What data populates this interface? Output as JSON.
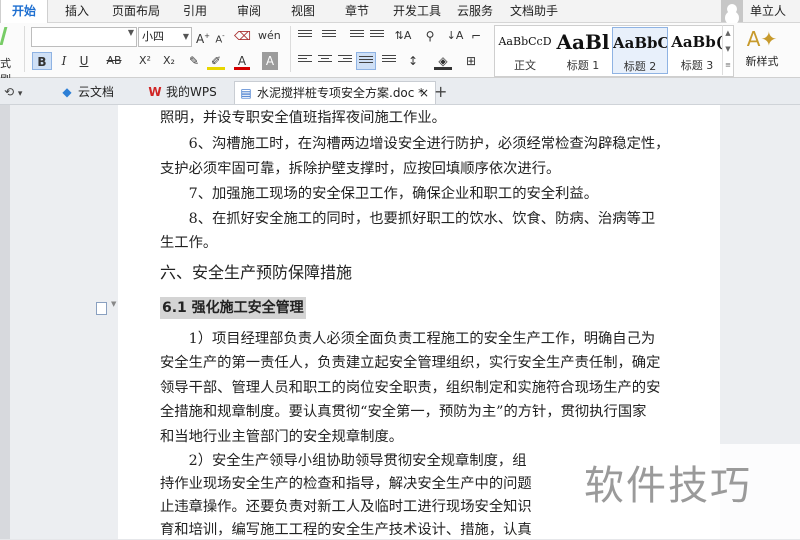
{
  "menu": {
    "tabs": [
      "开始",
      "插入",
      "页面布局",
      "引用",
      "审阅",
      "视图",
      "章节",
      "开发工具",
      "云服务",
      "文档助手"
    ],
    "active": "开始",
    "user_label": "单立人"
  },
  "ribbon": {
    "format_painter_label": "式刷",
    "font_name": "",
    "font_size": "小四",
    "icons": [
      "bold-icon",
      "italic-icon",
      "underline-icon",
      "strikethrough-icon",
      "superscript-icon",
      "subscript-icon",
      "highlight-icon",
      "font-color-icon",
      "char-shading-icon",
      "bullet-list-icon",
      "numbered-list-icon",
      "align-left-icon",
      "align-center-icon",
      "align-right-icon",
      "justify-icon",
      "distribute-icon",
      "line-spacing-icon",
      "sort-icon",
      "borders-icon",
      "shading-icon",
      "new-style-icon"
    ],
    "styles": [
      {
        "preview": "AaBbCcD",
        "name": "正文"
      },
      {
        "preview": "AaBl",
        "name": "标题 1"
      },
      {
        "preview": "AaBbC",
        "name": "标题 2"
      },
      {
        "preview": "AaBb(",
        "name": "标题 3"
      }
    ],
    "selected_style": "标题 2",
    "new_style_label": "新样式"
  },
  "tabbar": {
    "tabs": [
      {
        "label": "云文档",
        "icon": "cloud-doc-icon"
      },
      {
        "label": "我的WPS",
        "icon": "wps-logo-icon"
      },
      {
        "label": "水泥搅拌桩专项安全方案.doc *",
        "icon": "word-doc-icon",
        "active": true
      }
    ],
    "new_tab": "+"
  },
  "document": {
    "lines": [
      "照明，并设专职安全值班指挥夜间施工作业。",
      "　　6、沟槽施工时，在沟槽两边增设安全进行防护，必须经常检查沟辟稳定性，",
      "支护必须牢固可靠，拆除护壁支撑时，应按回填顺序依次进行。",
      "　　7、加强施工现场的安全保卫工作，确保企业和职工的安全利益。",
      "　　8、在抓好安全施工的同时，也要抓好职工的饮水、饮食、防病、治病等卫",
      "生工作。"
    ],
    "heading": "六、安全生产预防保障措施",
    "subheading": "6.1 强化施工安全管理",
    "para1": [
      "　　1）项目经理部负责人必须全面负责工程施工的安全生产工作，明确自己为",
      "安全生产的第一责任人，负责建立起安全管理组织，实行安全生产责任制，确定",
      "领导干部、管理人员和职工的岗位安全职责，组织制定和实施符合现场生产的安",
      "全措施和规章制度。要认真贯彻“安全第一，预防为主”的方针，贯彻执行国家",
      "和当地行业主管部门的安全规章制度。"
    ],
    "para2": [
      "　　2）安全生产领导小组协助领导贯彻安全规章制度，组",
      "持作业现场安全生产的检查和指导，解决安全生产中的问题",
      "止违章操作。还要负责对新工人及临时工进行现场安全知识",
      "育和培训，编写施工工程的安全生产技术设计、措施，认真"
    ]
  },
  "watermark": "软件技巧"
}
